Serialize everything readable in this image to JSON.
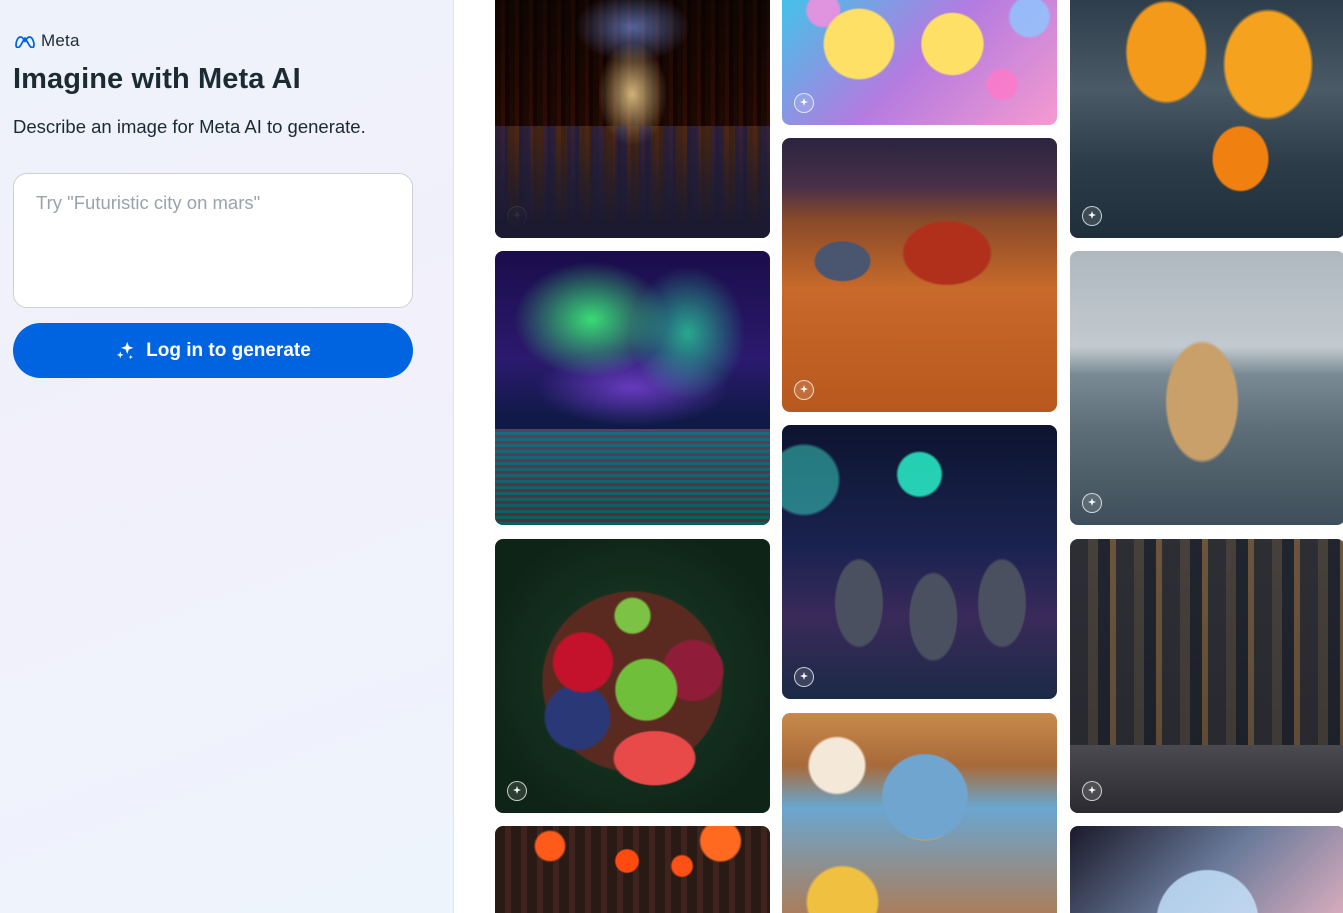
{
  "brand": {
    "logo_icon": "meta-infinity-logo",
    "name": "Meta"
  },
  "header": {
    "title": "Imagine with Meta AI",
    "subtitle": "Describe an image for Meta AI to generate."
  },
  "prompt": {
    "value": "",
    "placeholder": "Try \"Futuristic city on mars\""
  },
  "login_button": {
    "icon": "sparkle-icon",
    "label": "Log in to generate"
  },
  "colors": {
    "accent": "#0064e0",
    "text": "#1c2b33",
    "placeholder": "#9aa3ab"
  },
  "gallery": {
    "badge_icon": "meta-ai-sparkle-badge",
    "tiles": [
      {
        "id": "library",
        "subject": "fantasy library"
      },
      {
        "id": "aurora",
        "subject": "aurora over lake"
      },
      {
        "id": "fruit",
        "subject": "fruit platter"
      },
      {
        "id": "lanterns",
        "subject": "red lanterns"
      },
      {
        "id": "ducks",
        "subject": "rubber ducks with bubbles"
      },
      {
        "id": "mars",
        "subject": "race cars on mars"
      },
      {
        "id": "space",
        "subject": "space cats in suits"
      },
      {
        "id": "bird",
        "subject": "fluffy cartoon bird"
      },
      {
        "id": "butterfly",
        "subject": "butterfly in street"
      },
      {
        "id": "dog",
        "subject": "dog in the sea"
      },
      {
        "id": "city",
        "subject": "futuristic city with car"
      },
      {
        "id": "bubble",
        "subject": "cat in bubble"
      }
    ]
  }
}
